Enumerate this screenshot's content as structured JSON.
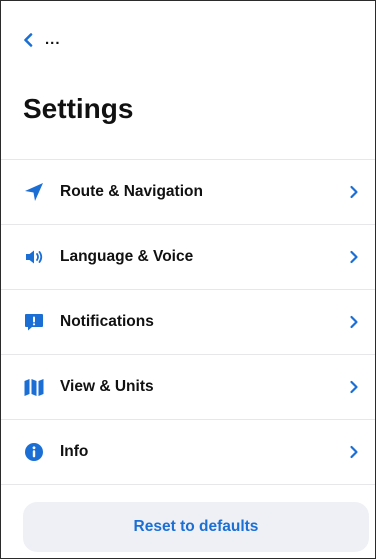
{
  "header": {
    "back_label": "...",
    "title": "Settings"
  },
  "menu": [
    {
      "label": "Route & Navigation",
      "icon": "navigation-arrow-icon"
    },
    {
      "label": "Language & Voice",
      "icon": "speaker-icon"
    },
    {
      "label": "Notifications",
      "icon": "notification-bubble-icon"
    },
    {
      "label": "View & Units",
      "icon": "map-icon"
    },
    {
      "label": "Info",
      "icon": "info-icon"
    }
  ],
  "reset_label": "Reset to defaults",
  "colors": {
    "accent": "#1b6fd4",
    "text": "#111111",
    "button_bg": "#eff0f5",
    "divider": "#e7e7ea"
  }
}
